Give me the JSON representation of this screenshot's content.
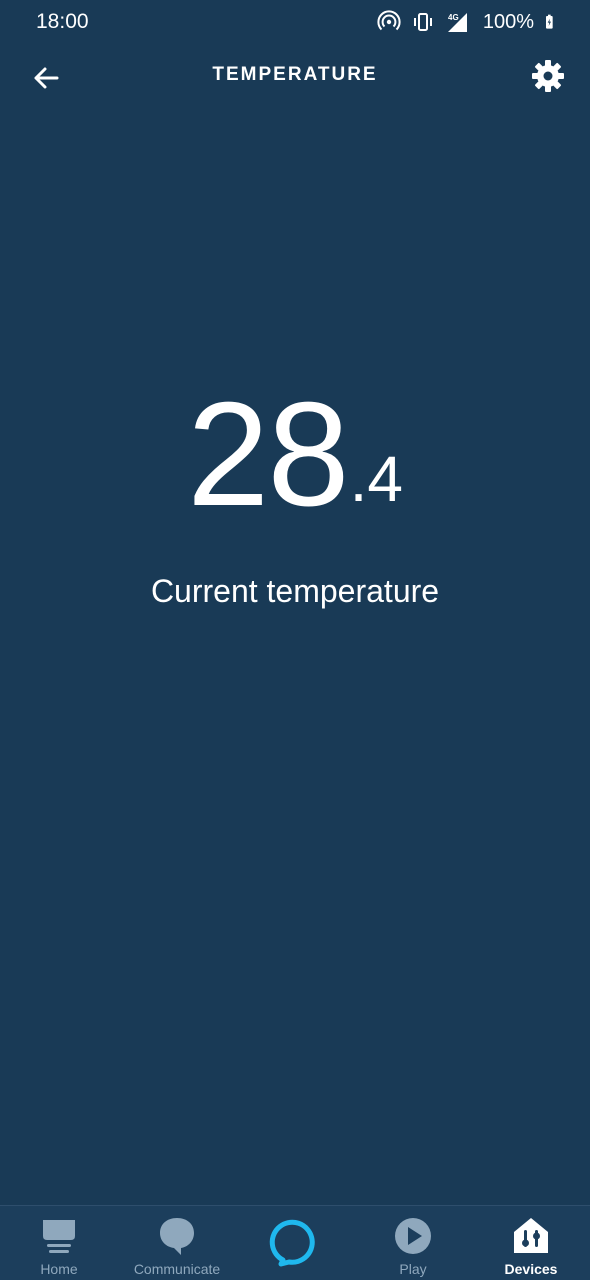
{
  "status_bar": {
    "time": "18:00",
    "battery": "100%",
    "icons": [
      "hotspot-icon",
      "vibrate-icon",
      "signal-4g-icon",
      "battery-charging-icon"
    ]
  },
  "header": {
    "title": "TEMPERATURE",
    "back_icon": "arrow-left-icon",
    "settings_icon": "gear-icon"
  },
  "reading": {
    "integer": "28",
    "decimal": ".4",
    "label": "Current temperature"
  },
  "bottom_nav": {
    "items": [
      {
        "label": "Home",
        "icon": "home-icon"
      },
      {
        "label": "Communicate",
        "icon": "chat-bubble-icon"
      },
      {
        "label": "",
        "icon": "alexa-ring-icon"
      },
      {
        "label": "Play",
        "icon": "play-icon"
      },
      {
        "label": "Devices",
        "icon": "devices-icon"
      }
    ],
    "active": "Devices"
  },
  "colors": {
    "background": "#193a56",
    "nav_background": "#1c3e5c",
    "alexa_accent": "#1fb8ee",
    "inactive": "#8fa8bd"
  }
}
